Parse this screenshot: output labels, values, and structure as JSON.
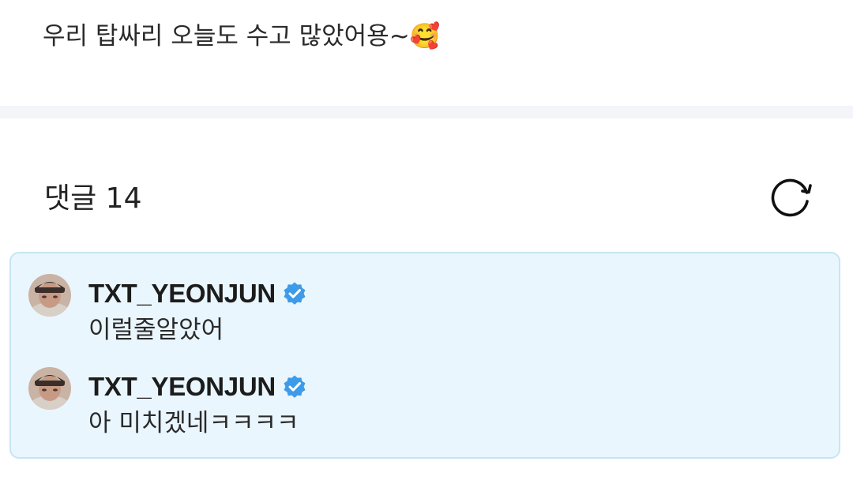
{
  "post": {
    "text": "우리 탑싸리 오늘도 수고 많았어용~🥰"
  },
  "comments_section": {
    "header": "댓글 14",
    "refresh_icon": "refresh-icon",
    "highlight_bg": "#eaf6fd",
    "highlight_border": "#c7e5f1",
    "items": [
      {
        "author": "TXT_YEONJUN",
        "verified_icon": "verified-badge-icon",
        "body": "이럴줄알았어"
      },
      {
        "author": "TXT_YEONJUN",
        "verified_icon": "verified-badge-icon",
        "body": "아 미치겠네ㅋㅋㅋㅋ"
      }
    ]
  },
  "colors": {
    "verified_badge": "#3d9be9",
    "divider": "#f4f5f9"
  }
}
